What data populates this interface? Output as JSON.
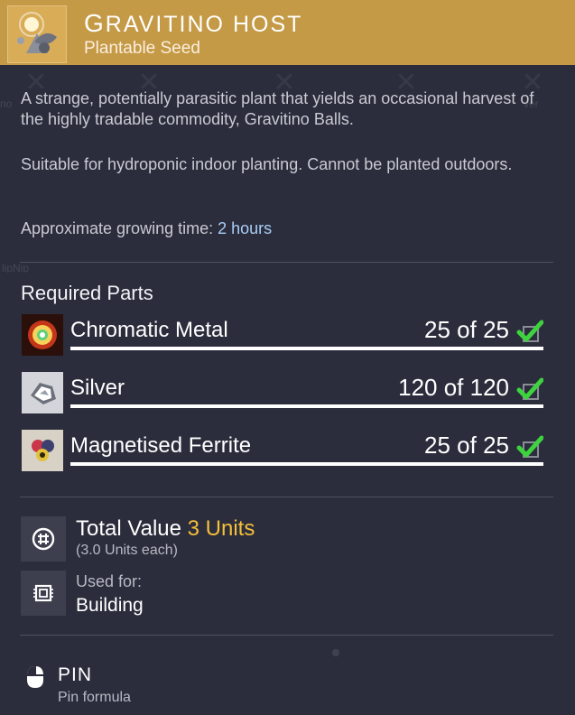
{
  "header": {
    "title": "GRAVITINO HOST",
    "subtitle": "Plantable Seed",
    "icon": "gravitino-host-seed-icon",
    "bg_color": "#c59a46"
  },
  "description": {
    "p1": "A strange, potentially parasitic plant that yields an occasional harvest of the highly tradable commodity, Gravitino Balls.",
    "p2": "Suitable for hydroponic indoor planting. Cannot be planted outdoors.",
    "growing_label": "Approximate growing time:",
    "growing_value": "2 hours"
  },
  "required_parts": {
    "title": "Required Parts",
    "items": [
      {
        "name": "Chromatic Metal",
        "quantity": "25 of 25",
        "icon": "chromatic-metal-icon",
        "complete": true
      },
      {
        "name": "Silver",
        "quantity": "120 of 120",
        "icon": "silver-icon",
        "complete": true
      },
      {
        "name": "Magnetised Ferrite",
        "quantity": "25 of 25",
        "icon": "magnetised-ferrite-icon",
        "complete": true
      }
    ]
  },
  "value": {
    "label": "Total Value",
    "amount": "3 Units",
    "each": "(3.0 Units each)",
    "icon": "units-currency-icon",
    "accent": "#f5bf3a"
  },
  "used_for": {
    "label": "Used for:",
    "value": "Building",
    "icon": "chip-icon"
  },
  "pin": {
    "label": "PIN",
    "sub": "Pin formula",
    "icon": "mouse-icon"
  },
  "background": {
    "ghost_left": "no",
    "ghost_right": "ver",
    "ghost_name": "lipNip"
  },
  "colors": {
    "highlight": "#a9cdf6",
    "check": "#3ed23e"
  }
}
